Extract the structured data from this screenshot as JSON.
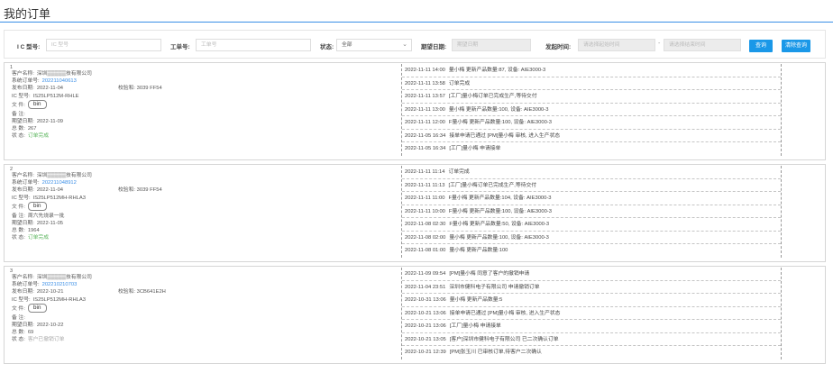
{
  "page": {
    "title": "我的订单"
  },
  "search": {
    "ic_label": "I C 型号:",
    "ic_placeholder": "IC 型号",
    "work_label": "工单号:",
    "work_placeholder": "工单号",
    "status_label": "状态:",
    "status_value": "全部",
    "expect_label": "期望日期:",
    "expect_placeholder": "期望日期",
    "start_label": "发起时间:",
    "start_begin_placeholder": "请选择起始时间",
    "start_sep": "-",
    "start_end_placeholder": "请选择结束时间",
    "query_button": "查询",
    "clear_button": "清除查询"
  },
  "orders": [
    {
      "index": "1",
      "customer_label": "客户名称:",
      "customer": "深圳▒▒▒▒▒技有限公司",
      "sysno_label": "系统订单号:",
      "sysno": "202211040613",
      "date_label": "发布日期:",
      "date": "2022-11-04",
      "checksum_label": "校验和:",
      "checksum": "3039 FF54",
      "ic_label": "IC  型号:",
      "ic": "IS25LP512M-RHLE",
      "file_label": "文      件:",
      "file_button": "bin",
      "note_label": "备      注:",
      "note": "",
      "expect_label": "期望日期:",
      "expect": "2022-11-09",
      "total_label": "总      数:",
      "total": "267",
      "status_label": "状      态:",
      "status": "订单完成",
      "logs": [
        {
          "time": "2022-11-11 14:00",
          "text": "量小梅 更新产品数量:87, 设备: AIE3000-3"
        },
        {
          "time": "2022-11-11 13:58",
          "text": "订单完成"
        },
        {
          "time": "2022-11-11 13:57",
          "text": "[工厂]量小梅订单已完成生产,等待交付"
        },
        {
          "time": "2022-11-11 13:00",
          "text": "量小梅 更新产品数量:100, 设备: AIE3000-3"
        },
        {
          "time": "2022-11-11 12:00",
          "text": "F量小梅 更新产品数量:100, 设备: AIE3000-3"
        },
        {
          "time": "2022-11-05 16:34",
          "text": "接单申请已通过 [PM]量小梅 审核, 进入生产状态"
        },
        {
          "time": "2022-11-05 16:34",
          "text": "[工厂]量小梅 申请接单"
        }
      ]
    },
    {
      "index": "2",
      "customer_label": "客户名称:",
      "customer": "深圳▒▒▒▒▒技有限公司",
      "sysno_label": "系统订单号:",
      "sysno": "202211048912",
      "date_label": "发布日期:",
      "date": "2022-11-04",
      "checksum_label": "校验和:",
      "checksum": "3039 FF54",
      "ic_label": "IC  型号:",
      "ic": "IS25LP512MH-RHLA3",
      "file_label": "文      件:",
      "file_button": "bin",
      "note_label": "备      注:",
      "note": "周六先烧录一批",
      "expect_label": "期望日期:",
      "expect": "2022-11-05",
      "total_label": "总      数:",
      "total": "1964",
      "status_label": "状      态:",
      "status": "订单完成",
      "logs": [
        {
          "time": "2022-11-11 11:14",
          "text": "订单完成"
        },
        {
          "time": "2022-11-11 11:13",
          "text": "[工厂]量小梅订单已完成生产,等待交付"
        },
        {
          "time": "2022-11-11 11:00",
          "text": "F量小梅 更新产品数量:104, 设备: AIE3000-3"
        },
        {
          "time": "2022-11-11 10:00",
          "text": "F量小梅 更新产品数量:100, 设备: AIE3000-3"
        },
        {
          "time": "2022-11-08 02:30",
          "text": "F量小梅 更新产品数量:50, 设备: AIE3000-3"
        },
        {
          "time": "2022-11-08 02:00",
          "text": "量小梅 更新产品数量:100, 设备: AIE3000-3"
        },
        {
          "time": "2022-11-08 01:00",
          "text": "量小梅 更新产品数量:100"
        }
      ]
    },
    {
      "index": "3",
      "customer_label": "客户名称:",
      "customer": "深圳▒▒▒▒▒技有限公司",
      "sysno_label": "系统订单号:",
      "sysno": "202210210703",
      "date_label": "发布日期:",
      "date": "2022-10-21",
      "checksum_label": "校验和:",
      "checksum": "3CB641E2H",
      "ic_label": "IC  型号:",
      "ic": "IS25LP512MH-RHLA3",
      "file_label": "文      件:",
      "file_button": "bin",
      "note_label": "备      注:",
      "note": "",
      "expect_label": "期望日期:",
      "expect": "2022-10-22",
      "total_label": "总      数:",
      "total": "69",
      "status_label": "状      态:",
      "status": "客户已撤销订单",
      "logs": [
        {
          "time": "2022-11-09 09:54",
          "text": "[PM]量小梅 同意了客户的撤销申请"
        },
        {
          "time": "2022-11-04 23:51",
          "text": "深圳市健科电子有限公司 申请撤销订单"
        },
        {
          "time": "2022-10-31 13:06",
          "text": "量小梅 更新产品数量:5"
        },
        {
          "time": "2022-10-21 13:06",
          "text": "接单申请已通过 [PM]量小梅 审核, 进入生产状态"
        },
        {
          "time": "2022-10-21 13:06",
          "text": "[工厂]量小梅 申请接单"
        },
        {
          "time": "2022-10-21 13:05",
          "text": "[客户]深圳市健科电子有限公司 已二次确认订单"
        },
        {
          "time": "2022-10-21 12:39",
          "text": "[PM]张玉川 已审核订单,待客户二次确认"
        }
      ]
    }
  ]
}
